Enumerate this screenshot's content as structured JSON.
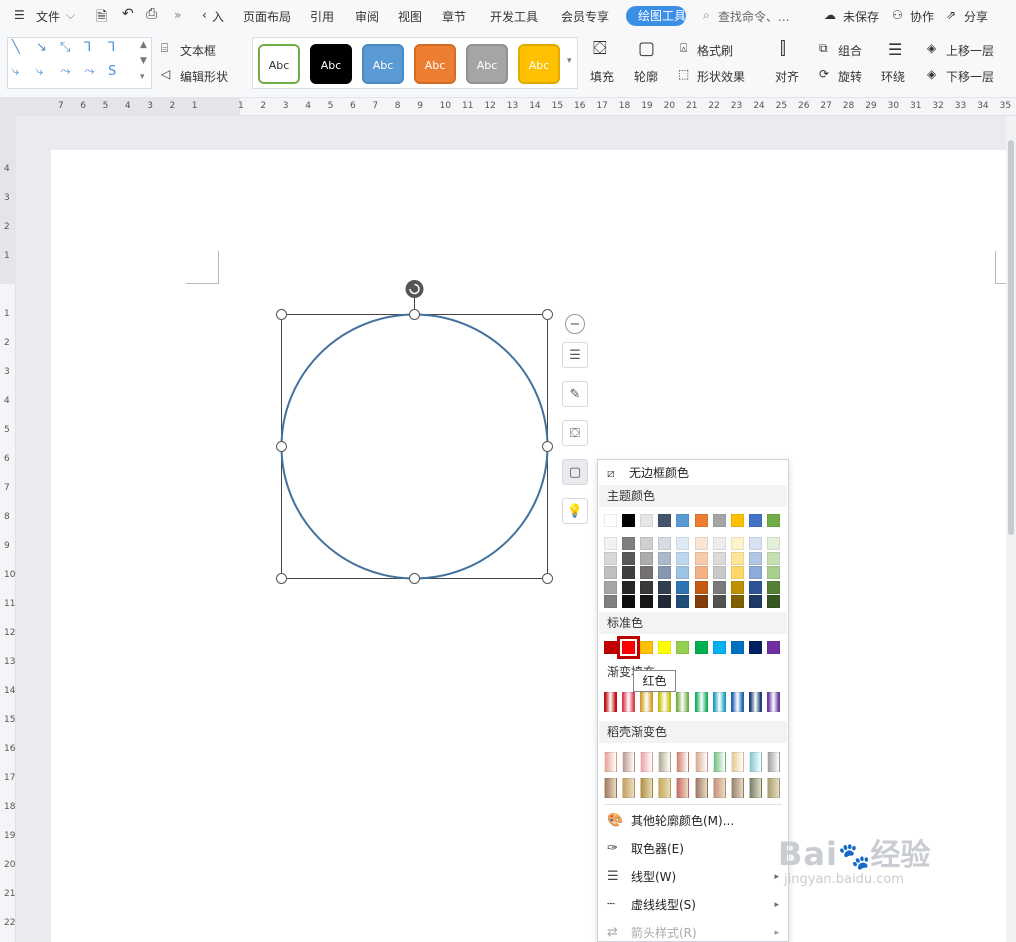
{
  "topbar": {
    "file_menu": "文件",
    "tabs": [
      "入",
      "页面布局",
      "引用",
      "审阅",
      "视图",
      "章节",
      "开发工具",
      "会员专享"
    ],
    "active_tab": "绘图工具",
    "search_placeholder": "查找命令、...",
    "unsaved": "未保存",
    "collaborate": "协作",
    "share": "分享"
  },
  "ribbon": {
    "textbox": "文本框",
    "edit_shape": "编辑形状",
    "style_label": "Abc",
    "fill": "填充",
    "outline": "轮廓",
    "format_painter": "格式刷",
    "shape_effects": "形状效果",
    "align": "对齐",
    "group": "组合",
    "rotate": "旋转",
    "wrap": "环绕",
    "bring_forward": "上移一层",
    "send_backward": "下移一层",
    "styles": [
      {
        "bg": "#ffffff",
        "fg": "#333333",
        "border": "#70ad47"
      },
      {
        "bg": "#000000",
        "fg": "#ffffff",
        "border": "#000000"
      },
      {
        "bg": "#5b9bd5",
        "fg": "#ffffff",
        "border": "#4a89c3"
      },
      {
        "bg": "#ed7d31",
        "fg": "#ffffff",
        "border": "#d46b22"
      },
      {
        "bg": "#a5a5a5",
        "fg": "#ffffff",
        "border": "#919191"
      },
      {
        "bg": "#ffc000",
        "fg": "#ffffff",
        "border": "#e0a800"
      }
    ]
  },
  "ruler": {
    "h_left": [
      "7",
      "6",
      "5",
      "4",
      "3",
      "2",
      "1"
    ],
    "h_right": [
      "1",
      "2",
      "3",
      "4",
      "5",
      "6",
      "7",
      "8",
      "9",
      "10",
      "11",
      "12",
      "13",
      "14",
      "15",
      "16",
      "17",
      "18",
      "19",
      "20",
      "21",
      "22",
      "23",
      "24",
      "25",
      "26",
      "27",
      "28",
      "29",
      "30",
      "31",
      "32",
      "33",
      "34",
      "35"
    ],
    "v_top": [
      "4",
      "3",
      "2",
      "1"
    ],
    "v_bottom": [
      "1",
      "2",
      "3",
      "4",
      "5",
      "6",
      "7",
      "8",
      "9",
      "10",
      "11",
      "12",
      "13",
      "14",
      "15",
      "16",
      "17",
      "18",
      "19",
      "20",
      "21",
      "22"
    ]
  },
  "shape": {
    "stroke_color": "#41719c"
  },
  "outline_menu": {
    "no_outline": "无边框颜色",
    "theme_colors_title": "主题颜色",
    "theme_row": [
      "#ffffff",
      "#000000",
      "#e7e6e6",
      "#44546a",
      "#5b9bd5",
      "#ed7d31",
      "#a5a5a5",
      "#ffc000",
      "#4472c4",
      "#70ad47"
    ],
    "theme_shades": [
      [
        "#f2f2f2",
        "#7f7f7f",
        "#d0cece",
        "#d6dce4",
        "#deebf6",
        "#fbe5d5",
        "#ededed",
        "#fff2cc",
        "#d9e2f3",
        "#e2efd9"
      ],
      [
        "#d8d8d8",
        "#595959",
        "#aeabab",
        "#adb9ca",
        "#bdd7ee",
        "#f7cbac",
        "#dbdbdb",
        "#fee599",
        "#b4c6e7",
        "#c5e0b3"
      ],
      [
        "#bfbfbf",
        "#3f3f3f",
        "#757070",
        "#8496b0",
        "#9dc3e6",
        "#f4b183",
        "#c9c9c9",
        "#ffd965",
        "#8eaadb",
        "#a8d08d"
      ],
      [
        "#a5a5a5",
        "#262626",
        "#3a3838",
        "#323f4f",
        "#2e75b5",
        "#c55a11",
        "#7b7b7b",
        "#bf9000",
        "#2f5496",
        "#538135"
      ],
      [
        "#7f7f7f",
        "#0c0c0c",
        "#171616",
        "#222a35",
        "#1f4e79",
        "#833c0b",
        "#525252",
        "#7f6000",
        "#1f3864",
        "#375623"
      ]
    ],
    "standard_title": "标准色",
    "standard_colors": [
      "#c00000",
      "#ff0000",
      "#ffc000",
      "#ffff00",
      "#92d050",
      "#00b050",
      "#00b0f0",
      "#0070c0",
      "#002060",
      "#7030a0"
    ],
    "gradient_title": "渐变填充",
    "gradient_colors": [
      "#c00000",
      "#e0344c",
      "#d4a020",
      "#c8c000",
      "#70b040",
      "#10b060",
      "#10a0c0",
      "#1060b0",
      "#103070",
      "#6030a0"
    ],
    "shell_gradient_title": "稻壳渐变色",
    "shell_row1": [
      "#e8a090",
      "#c09890",
      "#f0a0a8",
      "#b0a890",
      "#d08070",
      "#d8a890",
      "#70c080",
      "#e8c890",
      "#80c8d0",
      "#a0a0a0"
    ],
    "shell_row2": [
      "#a07860",
      "#c8a060",
      "#b09040",
      "#c8a850",
      "#d06868",
      "#a07868",
      "#c89080",
      "#988070",
      "#708070",
      "#a8a070"
    ],
    "tooltip": "红色",
    "other_colors": "其他轮廓颜色(M)...",
    "eyedropper": "取色器(E)",
    "line_type": "线型(W)",
    "dash_type": "虚线线型(S)",
    "arrow_style": "箭头样式(R)"
  },
  "watermark": {
    "brand": "Bai",
    "brand2": "经验",
    "url": "jingyan.baidu.com"
  }
}
